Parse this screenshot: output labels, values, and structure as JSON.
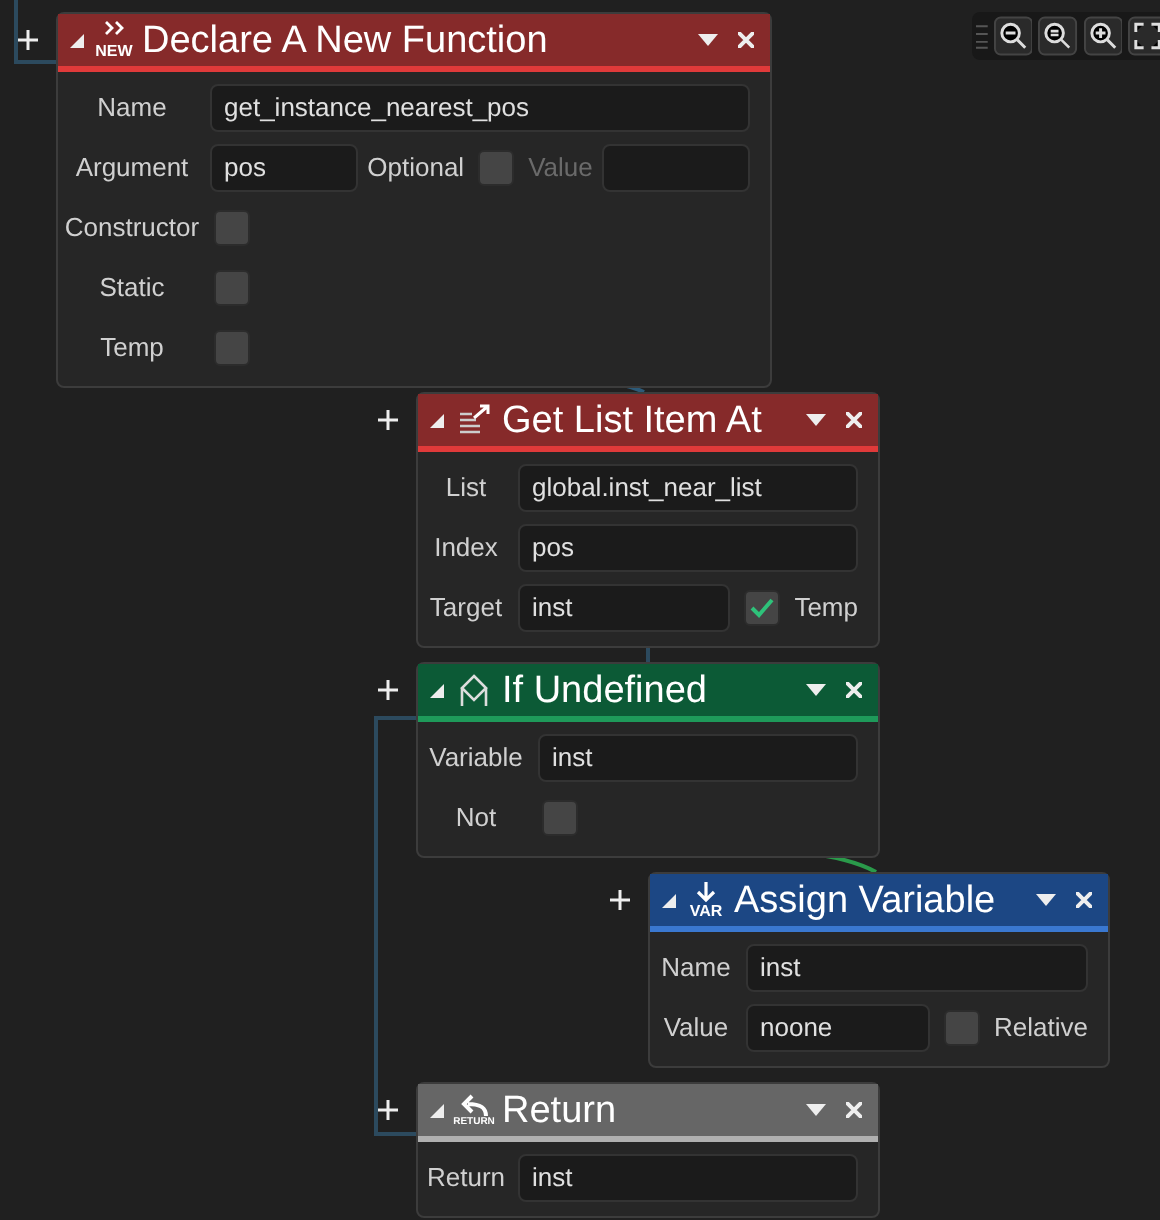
{
  "nodes": [
    {
      "kind": "function",
      "title": "Declare A New Function",
      "icon_label": "NEW",
      "rows": [
        [
          {
            "kind": "label",
            "text": "Name",
            "disabled": false
          },
          {
            "kind": "field",
            "value": "get_instance_nearest_pos"
          }
        ],
        [
          {
            "kind": "label",
            "text": "Argument",
            "disabled": false
          },
          {
            "kind": "field",
            "value": "pos"
          },
          {
            "kind": "label",
            "text": "Optional",
            "disabled": false
          },
          {
            "kind": "checkbox",
            "checked": false
          },
          {
            "kind": "label",
            "text": "Value",
            "disabled": true
          },
          {
            "kind": "field"
          }
        ],
        [
          {
            "kind": "label",
            "text": "Constructor",
            "disabled": false
          },
          {
            "kind": "checkbox",
            "checked": false
          }
        ],
        [
          {
            "kind": "label",
            "text": "Static",
            "disabled": false
          },
          {
            "kind": "checkbox",
            "checked": false
          }
        ],
        [
          {
            "kind": "label",
            "text": "Temp",
            "disabled": false
          },
          {
            "kind": "checkbox",
            "checked": false
          }
        ]
      ]
    },
    {
      "kind": "list",
      "title": "Get List Item At",
      "rows": [
        [
          {
            "kind": "label",
            "text": "List",
            "disabled": false
          },
          {
            "kind": "field",
            "value": "global.inst_near_list"
          }
        ],
        [
          {
            "kind": "label",
            "text": "Index",
            "disabled": false
          },
          {
            "kind": "field",
            "value": "pos"
          }
        ],
        [
          {
            "kind": "label",
            "text": "Target",
            "disabled": false
          },
          {
            "kind": "field",
            "value": "inst"
          },
          {
            "kind": "checkbox",
            "checked": true
          },
          {
            "kind": "label",
            "text": "Temp",
            "disabled": false
          }
        ]
      ]
    },
    {
      "kind": "condition",
      "title": "If Undefined",
      "rows": [
        [
          {
            "kind": "label",
            "text": "Variable",
            "disabled": false
          },
          {
            "kind": "field",
            "value": "inst"
          }
        ],
        [
          {
            "kind": "label",
            "text": "Not",
            "disabled": false
          },
          {
            "kind": "checkbox",
            "checked": false
          }
        ]
      ]
    },
    {
      "kind": "variable",
      "title": "Assign Variable",
      "icon_label": "VAR",
      "rows": [
        [
          {
            "kind": "label",
            "text": "Name",
            "disabled": false
          },
          {
            "kind": "field",
            "value": "inst"
          }
        ],
        [
          {
            "kind": "label",
            "text": "Value",
            "disabled": false
          },
          {
            "kind": "field",
            "value": "noone"
          },
          {
            "kind": "checkbox",
            "checked": false
          },
          {
            "kind": "label",
            "text": "Relative",
            "disabled": false
          }
        ]
      ]
    },
    {
      "kind": "return",
      "title": "Return",
      "icon_label": "RETURN",
      "rows": [
        [
          {
            "kind": "label",
            "text": "Return",
            "disabled": false
          },
          {
            "kind": "field",
            "value": "inst"
          }
        ]
      ]
    }
  ]
}
